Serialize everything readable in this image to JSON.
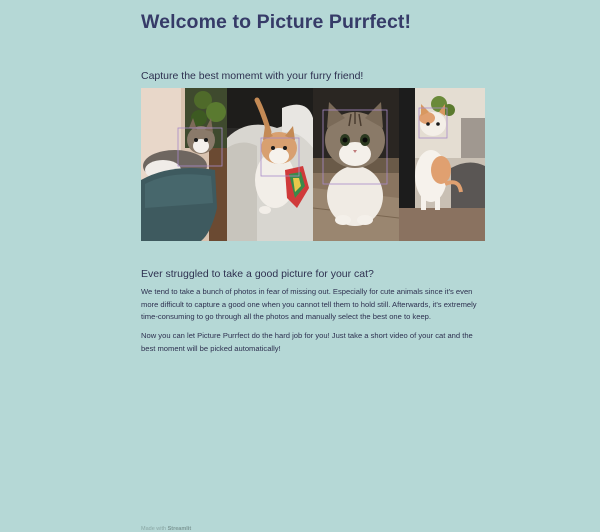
{
  "page": {
    "title": "Welcome to Picture Purrfect!",
    "subtitle": "Capture the best momemt with your furry friend!"
  },
  "photos": [
    {
      "name": "cat-photo-1"
    },
    {
      "name": "cat-photo-2"
    },
    {
      "name": "cat-photo-3"
    },
    {
      "name": "cat-photo-4"
    }
  ],
  "section": {
    "heading": "Ever struggled to take a good picture for your cat?",
    "paragraph1": "We tend to take a bunch of photos in fear of missing out. Especially for cute animals since it's even more difficult to capture a good one when you cannot tell them to hold still. Afterwards, it's extremely time-consuming to go through all the photos and manually select the best one to keep.",
    "paragraph2": "Now you can let Picture Purrfect do the hard job for you! Just take a short video of your cat and the best moment will be picked automatically!"
  },
  "footer": {
    "prefix": "Made with",
    "brand": "Streamlit"
  },
  "colors": {
    "background": "#b5d8d6",
    "title": "#363b68",
    "text": "#2e3150",
    "detection_box": "#a88ac8"
  }
}
